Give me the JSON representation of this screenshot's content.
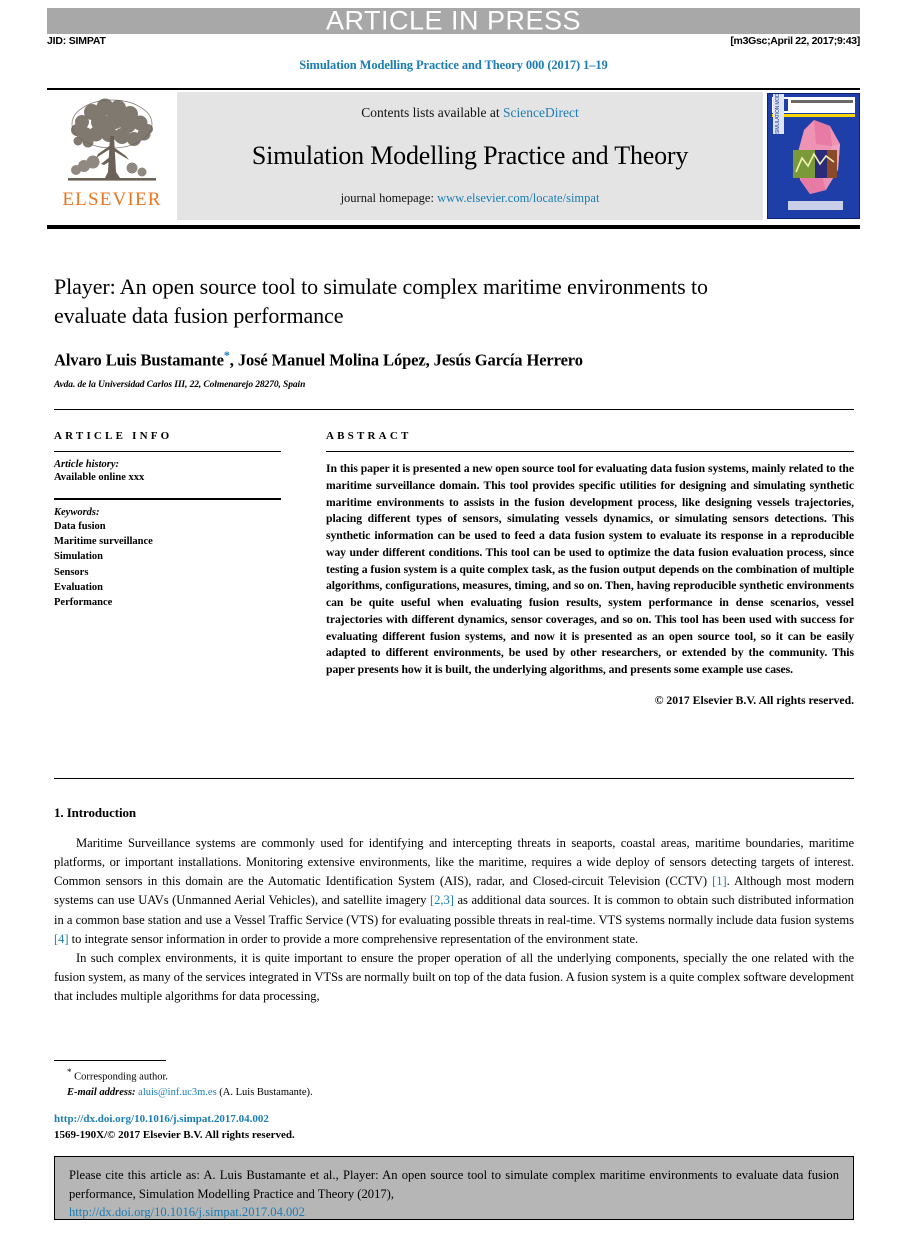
{
  "banner": {
    "press_text": "ARTICLE IN PRESS",
    "jid": "JID: SIMPAT",
    "stamp": "[m3Gsc;April 22, 2017;9:43]"
  },
  "running_head": "Simulation Modelling Practice and Theory 000 (2017) 1–19",
  "masthead": {
    "publisher": "ELSEVIER",
    "contents_prefix": "Contents lists available at ",
    "contents_link": "ScienceDirect",
    "journal_name": "Simulation Modelling Practice and Theory",
    "homepage_prefix": "journal homepage: ",
    "homepage_link": "www.elsevier.com/locate/simpat",
    "cover_spine": "SIMULATION MODELLING PRACTICE AND THEORY"
  },
  "article": {
    "title": "Player: An open source tool to simulate complex maritime environments to evaluate data fusion performance",
    "authors": "Alvaro Luis Bustamante",
    "authors_rest": ", José Manuel Molina López, Jesús García Herrero",
    "corresponding_marker": "*",
    "affiliation": "Avda. de la Universidad Carlos III, 22, Colmenarejo 28270, Spain"
  },
  "info": {
    "heading": "ARTICLE INFO",
    "history_label": "Article history:",
    "history_value": "Available online xxx",
    "keywords_label": "Keywords:",
    "keywords": [
      "Data fusion",
      "Maritime surveillance",
      "Simulation",
      "Sensors",
      "Evaluation",
      "Performance"
    ]
  },
  "abstract": {
    "heading": "ABSTRACT",
    "body": "In this paper it is presented a new open source tool for evaluating data fusion systems, mainly related to the maritime surveillance domain. This tool provides specific utilities for designing and simulating synthetic maritime environments to assists in the fusion development process, like designing vessels trajectories, placing different types of sensors, simulating vessels dynamics, or simulating sensors detections. This synthetic information can be used to feed a data fusion system to evaluate its response in a reproducible way under different conditions. This tool can be used to optimize the data fusion evaluation process, since testing a fusion system is a quite complex task, as the fusion output depends on the combination of multiple algorithms, configurations, measures, timing, and so on. Then, having reproducible synthetic environments can be quite useful when evaluating fusion results, system performance in dense scenarios, vessel trajectories with different dynamics, sensor coverages, and so on. This tool has been used with success for evaluating different fusion systems, and now it is presented as an open source tool, so it can be easily adapted to different environments, be used by other researchers, or extended by the community. This paper presents how it is built, the underlying algorithms, and presents some example use cases.",
    "copyright": "© 2017 Elsevier B.V. All rights reserved."
  },
  "introduction": {
    "heading": "1. Introduction",
    "p1_a": "Maritime Surveillance systems are commonly used for identifying and intercepting threats in seaports, coastal areas, maritime boundaries, maritime platforms, or important installations. Monitoring extensive environments, like the maritime, requires a wide deploy of sensors detecting targets of interest. Common sensors in this domain are the Automatic Identification System (AIS), radar, and Closed-circuit Television (CCTV) ",
    "ref1": "[1]",
    "p1_b": ". Although most modern systems can use UAVs (Unmanned Aerial Vehicles), and satellite imagery ",
    "ref23": "[2,3]",
    "p1_c": " as additional data sources. It is common to obtain such distributed information in a common base station and use a Vessel Traffic Service (VTS) for evaluating possible threats in real-time. VTS systems normally include data fusion systems ",
    "ref4": "[4]",
    "p1_d": " to integrate sensor information in order to provide a more comprehensive representation of the environment state.",
    "p2": "In such complex environments, it is quite important to ensure the proper operation of all the underlying components, specially the one related with the fusion system, as many of the services integrated in VTSs are normally built on top of the data fusion. A fusion system is a quite complex software development that includes multiple algorithms for data processing,"
  },
  "footnote": {
    "star": "*",
    "corresponding": "Corresponding author.",
    "email_label": "E-mail address:",
    "email": "aluis@inf.uc3m.es",
    "email_owner": "(A. Luis Bustamante).",
    "doi": "http://dx.doi.org/10.1016/j.simpat.2017.04.002",
    "issn_line": "1569-190X/© 2017 Elsevier B.V. All rights reserved."
  },
  "cite_box": {
    "text": "Please cite this article as: A. Luis Bustamante et al., Player: An open source tool to simulate complex maritime environments to evaluate data fusion performance, Simulation Modelling Practice and Theory (2017),",
    "doi": "http://dx.doi.org/10.1016/j.simpat.2017.04.002"
  },
  "colors": {
    "link": "#1b7db5",
    "banner_gray": "#a8a8a8",
    "elsevier_orange": "#e87722",
    "cover_blue": "#1e3fa8",
    "cite_box_gray": "#b6b6b6"
  }
}
